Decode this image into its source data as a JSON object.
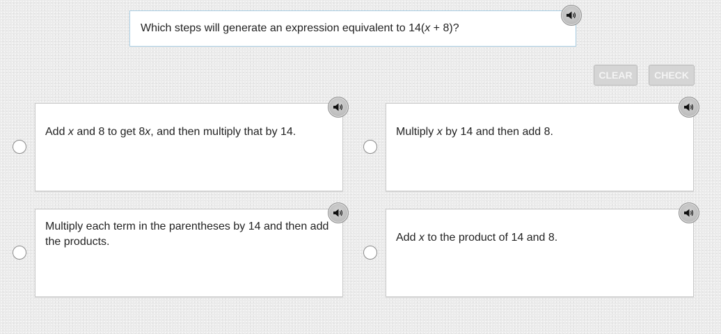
{
  "question": {
    "text_prefix": "Which steps will generate an expression equivalent to 14(",
    "text_variable": "x",
    "text_suffix": " + 8)?",
    "audio_icon": "speaker-icon"
  },
  "actions": {
    "clear_label": "CLEAR",
    "check_label": "CHECK"
  },
  "choices": [
    {
      "parts": [
        "Add ",
        "x",
        " and 8 to get 8",
        "x",
        ", and then multiply that by 14."
      ],
      "audio_icon": "speaker-icon",
      "selected": false
    },
    {
      "parts": [
        "Multiply ",
        "x",
        " by 14 and then add 8."
      ],
      "audio_icon": "speaker-icon",
      "selected": false
    },
    {
      "parts": [
        "Multiply each term in the parentheses by 14 and then add the products."
      ],
      "audio_icon": "speaker-icon",
      "selected": false
    },
    {
      "parts": [
        "Add ",
        "x",
        " to the product of 14 and 8."
      ],
      "audio_icon": "speaker-icon",
      "selected": false
    }
  ],
  "colors": {
    "background": "#ebebeb",
    "question_border": "#a9cde2",
    "button_disabled": "#d5d5d5",
    "button_text": "#f4f4f4",
    "audio_button": "#b3b3b3"
  }
}
